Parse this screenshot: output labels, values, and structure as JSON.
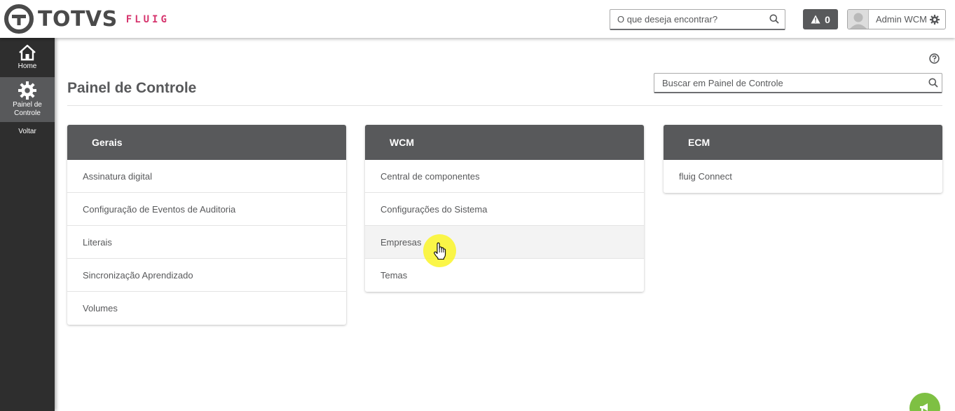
{
  "header": {
    "brand": "TOTVS",
    "product": "FLUIG",
    "search_placeholder": "O que deseja encontrar?",
    "alert_count": "0",
    "user_name": "Admin WCM"
  },
  "sidebar": {
    "items": [
      {
        "label": "Home",
        "icon": "home-icon"
      },
      {
        "label": "Painel de Controle",
        "icon": "gear-icon"
      }
    ],
    "back_label": "Voltar"
  },
  "page": {
    "title": "Painel de Controle",
    "search_placeholder": "Buscar em Painel de Controle"
  },
  "cards": [
    {
      "title": "Gerais",
      "items": [
        "Assinatura digital",
        "Configuração de Eventos de Auditoria",
        "Literais",
        "Sincronização Aprendizado",
        "Volumes"
      ]
    },
    {
      "title": "WCM",
      "items": [
        "Central de componentes",
        "Configurações do Sistema",
        "Empresas",
        "Temas"
      ]
    },
    {
      "title": "ECM",
      "items": [
        "fluig Connect"
      ]
    }
  ],
  "colors": {
    "header_dark": "#58595b",
    "sidebar_bg": "#2e2e2e",
    "brand_accent": "#d6356e",
    "fab_green": "#7ec043",
    "cursor_highlight": "#faf528"
  }
}
